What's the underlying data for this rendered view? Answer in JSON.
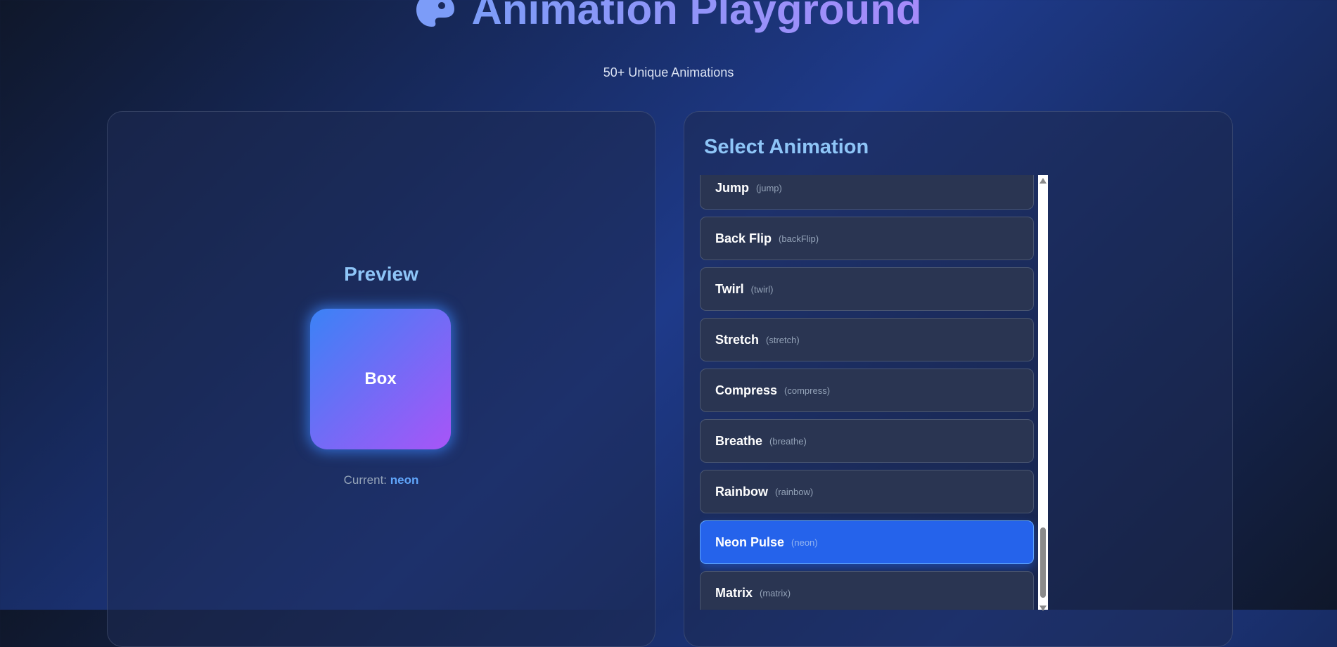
{
  "header": {
    "title": "Animation Playground",
    "subtitle": "50+ Unique Animations",
    "icon": "palette-icon"
  },
  "preview": {
    "title": "Preview",
    "box_label": "Box",
    "current_label": "Current:",
    "current_value": "neon"
  },
  "selector": {
    "title": "Select Animation",
    "items": [
      {
        "name": "Jump",
        "code": "(jump)"
      },
      {
        "name": "Back Flip",
        "code": "(backFlip)"
      },
      {
        "name": "Twirl",
        "code": "(twirl)"
      },
      {
        "name": "Stretch",
        "code": "(stretch)"
      },
      {
        "name": "Compress",
        "code": "(compress)"
      },
      {
        "name": "Breathe",
        "code": "(breathe)"
      },
      {
        "name": "Rainbow",
        "code": "(rainbow)"
      },
      {
        "name": "Neon Pulse",
        "code": "(neon)",
        "active": true
      },
      {
        "name": "Matrix",
        "code": "(matrix)"
      }
    ]
  },
  "colors": {
    "accent": "#2563eb",
    "heading": "#8ec5f7",
    "box_from": "#3b82f6",
    "box_to": "#a855f7"
  }
}
